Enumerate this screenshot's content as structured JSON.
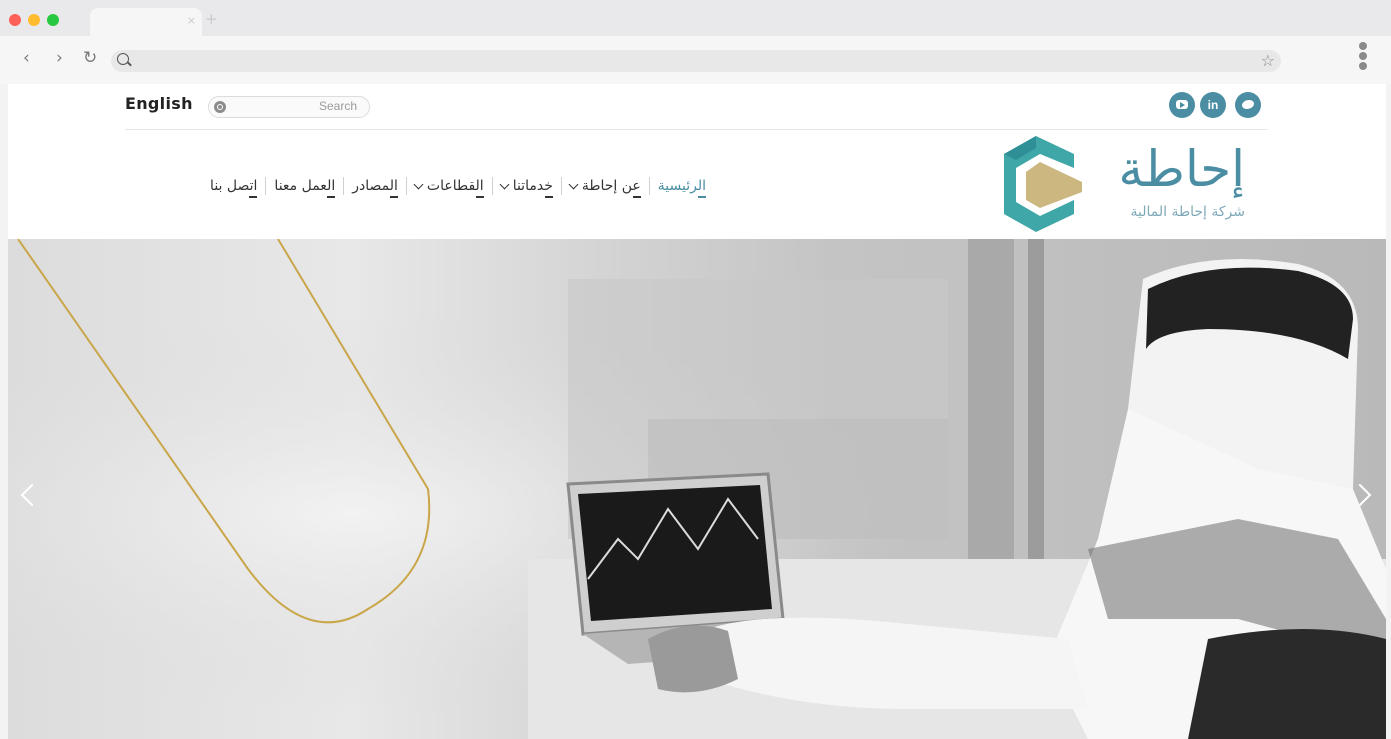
{
  "browser": {
    "tab_close": "×",
    "new_tab": "+",
    "back": "‹",
    "forward": "›",
    "reload": "↻",
    "star": "☆"
  },
  "header": {
    "language_link": "English",
    "search_placeholder": "Search",
    "social": [
      {
        "name": "youtube-icon"
      },
      {
        "name": "linkedin-icon",
        "label": "in"
      },
      {
        "name": "twitter-icon"
      }
    ],
    "social_color": "#4b8ea3"
  },
  "nav": {
    "items": [
      {
        "label": "الرئيسية",
        "active": true,
        "dropdown": false
      },
      {
        "label": "عن إحاطة",
        "active": false,
        "dropdown": true
      },
      {
        "label": "خدماتنا",
        "active": false,
        "dropdown": true
      },
      {
        "label": "القطاعات",
        "active": false,
        "dropdown": true
      },
      {
        "label": "المصادر",
        "active": false,
        "dropdown": false
      },
      {
        "label": "العمل معنا",
        "active": false,
        "dropdown": false
      },
      {
        "label": "اتصل بنا",
        "active": false,
        "dropdown": false
      }
    ],
    "accent_color": "#4b8ea3"
  },
  "logo": {
    "wordmark": "إحاطة",
    "subtitle": "شركة إحاطة المالية",
    "colors": {
      "teal": "#3fa7a8",
      "gold": "#c9b37a"
    }
  },
  "hero": {
    "accent_line_color": "#c9a649",
    "prev_arrow": "chevron-left-icon",
    "next_arrow": "chevron-right-icon"
  }
}
